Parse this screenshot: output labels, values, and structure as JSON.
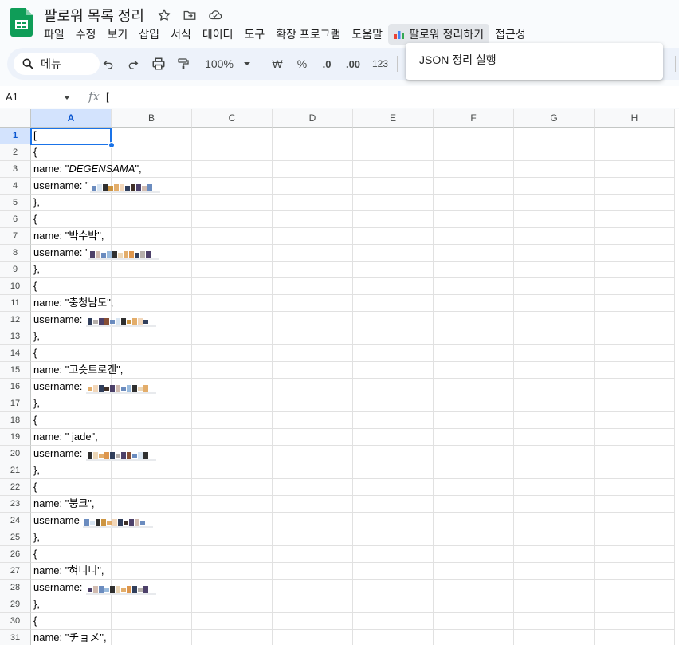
{
  "app": {
    "doc_title": "팔로워 목록 정리",
    "menu": [
      "파일",
      "수정",
      "보기",
      "삽입",
      "서식",
      "데이터",
      "도구",
      "확장 프로그램",
      "도움말"
    ],
    "custom_menu": "팔로워 정리하기",
    "accessibility_menu": "접근성"
  },
  "toolbar": {
    "search_label": "메뉴",
    "zoom": "100%",
    "currency": "₩",
    "percent": "%",
    "dec_decrease": ".0",
    "dec_increase": ".00",
    "number_format": "123"
  },
  "dropdown": {
    "item": "JSON 정리 실행"
  },
  "formula_bar": {
    "cell_ref": "A1",
    "fx": "fx",
    "content": "["
  },
  "columns": [
    "A",
    "B",
    "C",
    "D",
    "E",
    "F",
    "G",
    "H"
  ],
  "rows": [
    {
      "n": "1",
      "text": "["
    },
    {
      "n": "2",
      "text": "{"
    },
    {
      "n": "3",
      "prefix": "name: \"",
      "italic": "DEGENSAMA",
      "suffix": "\","
    },
    {
      "n": "4",
      "text": "username: \"",
      "redacted": true
    },
    {
      "n": "5",
      "text": "},"
    },
    {
      "n": "6",
      "text": "{"
    },
    {
      "n": "7",
      "text": "name: \"박수박\","
    },
    {
      "n": "8",
      "text": "username: '",
      "redacted": true
    },
    {
      "n": "9",
      "text": "},"
    },
    {
      "n": "10",
      "text": "{"
    },
    {
      "n": "11",
      "text": "name: \"충청남도\","
    },
    {
      "n": "12",
      "text": "username: ",
      "redacted": true
    },
    {
      "n": "13",
      "text": "},"
    },
    {
      "n": "14",
      "text": "{"
    },
    {
      "n": "15",
      "text": "name: \"고슷트로겐\","
    },
    {
      "n": "16",
      "text": "username: ",
      "redacted": true
    },
    {
      "n": "17",
      "text": "},"
    },
    {
      "n": "18",
      "text": "{"
    },
    {
      "n": "19",
      "text": "name: \" jade\","
    },
    {
      "n": "20",
      "text": "username: ",
      "redacted": true
    },
    {
      "n": "21",
      "text": "},"
    },
    {
      "n": "22",
      "text": "{"
    },
    {
      "n": "23",
      "text": "name: \"붕크\","
    },
    {
      "n": "24",
      "text": "username ",
      "redacted": true
    },
    {
      "n": "25",
      "text": "},"
    },
    {
      "n": "26",
      "text": "{"
    },
    {
      "n": "27",
      "text": "name: \"혀니니\","
    },
    {
      "n": "28",
      "text": "username: ",
      "redacted": true
    },
    {
      "n": "29",
      "text": "},"
    },
    {
      "n": "30",
      "text": "{"
    },
    {
      "n": "31",
      "text": "name: \"チョメ\","
    }
  ],
  "colors": {
    "accent": "#1a73e8",
    "selected_header": "#d3e3fd",
    "sheets_green": "#0f9d58"
  }
}
